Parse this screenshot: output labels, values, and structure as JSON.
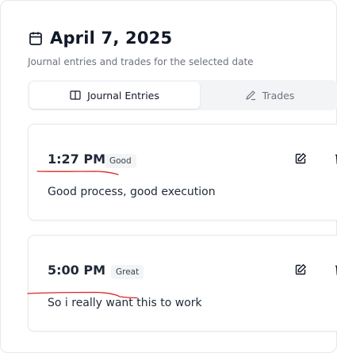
{
  "header": {
    "title": "April 7, 2025",
    "subtitle": "Journal entries and trades for the selected date"
  },
  "tabs": [
    {
      "label": "Journal Entries",
      "icon": "book-icon",
      "active": true
    },
    {
      "label": "Trades",
      "icon": "pencil-icon",
      "active": false
    }
  ],
  "entries": [
    {
      "time": "1:27 PM",
      "badge": "Good",
      "text": "Good process, good execution"
    },
    {
      "time": "5:00 PM",
      "badge": "Great",
      "text": "So i really want this to work"
    }
  ],
  "colors": {
    "annotation": "#dc2626",
    "border": "#e5e7eb",
    "tab_background": "#f3f4f6"
  }
}
